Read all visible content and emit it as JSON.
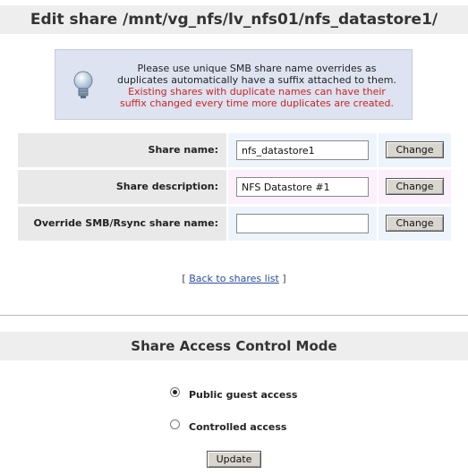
{
  "page": {
    "title": "Edit share /mnt/vg_nfs/lv_nfs01/nfs_datastore1/"
  },
  "info": {
    "icon": "lightbulb-icon",
    "line1": "Please use unique SMB share name overrides as",
    "line2": "duplicates automatically have a suffix attached to them.",
    "warn1": "Existing shares with duplicate names can have their",
    "warn2": "suffix changed every time more duplicates are created."
  },
  "form": {
    "rows": [
      {
        "label": "Share name:",
        "value": "nfs_datastore1",
        "button": "Change"
      },
      {
        "label": "Share description:",
        "value": "NFS Datastore #1",
        "button": "Change"
      },
      {
        "label": "Override SMB/Rsync share name:",
        "value": "",
        "button": "Change"
      }
    ]
  },
  "nav": {
    "open_bracket": "[",
    "back_link": "Back to shares list",
    "close_bracket": "]"
  },
  "access": {
    "title": "Share Access Control Mode",
    "options": [
      {
        "label": "Public guest access",
        "selected": true
      },
      {
        "label": "Controlled access",
        "selected": false
      }
    ],
    "update_label": "Update"
  }
}
